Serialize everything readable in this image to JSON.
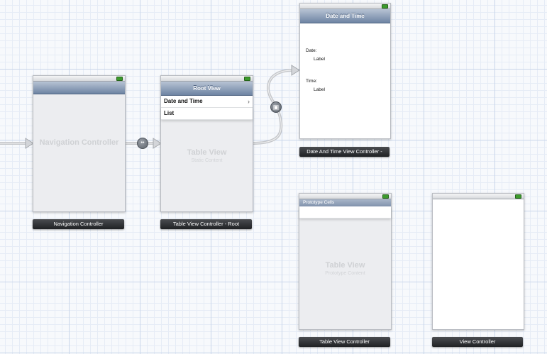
{
  "scenes": {
    "navigation_controller": {
      "placeholder": "Navigation Controller",
      "caption": "Navigation Controller"
    },
    "root": {
      "nav_title": "Root View",
      "cells": [
        {
          "label": "Date and Time",
          "accessory": "chevron-right-icon"
        },
        {
          "label": "List"
        }
      ],
      "placeholder_title": "Table View",
      "placeholder_subtitle": "Static Content",
      "caption": "Table View Controller - Root"
    },
    "date_time": {
      "nav_title": "Date and Time",
      "date_key": "Date:",
      "date_value": "Label",
      "time_key": "Time:",
      "time_value": "Label",
      "caption": "Date And Time View Controller -"
    },
    "table_view_controller": {
      "section_header": "Prototype Cells",
      "placeholder_title": "Table View",
      "placeholder_subtitle": "Prototype Content",
      "caption": "Table View Controller"
    },
    "view_controller": {
      "caption": "View Controller"
    }
  },
  "segues": [
    {
      "from": "entry",
      "to": "navigation_controller",
      "icon": "entry-arrow-icon"
    },
    {
      "from": "navigation_controller",
      "to": "root",
      "icon": "relationship-segue-icon"
    },
    {
      "from": "root",
      "to": "date_time",
      "icon": "push-segue-icon"
    }
  ],
  "colors": {
    "nav_bar": "#6e84a3",
    "caption_bg": "#2a2c30",
    "segue": "#c7c9cd",
    "grid": "#c9d6ea"
  }
}
